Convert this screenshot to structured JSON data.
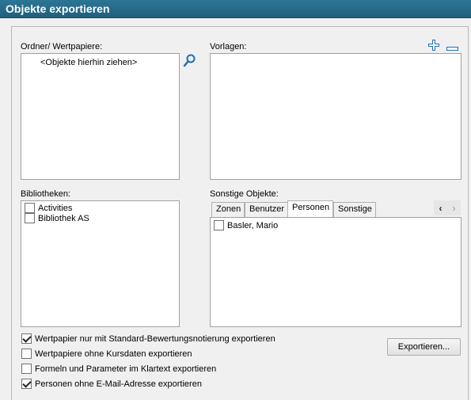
{
  "window": {
    "title": "Objekte exportieren"
  },
  "folders": {
    "label": "Ordner/ Wertpapiere:",
    "placeholder": "<Objekte hierhin ziehen>",
    "search_icon": "magnifier-icon"
  },
  "templates": {
    "label": "Vorlagen:",
    "add_icon": "plus-icon",
    "remove_icon": "minus-icon"
  },
  "libraries": {
    "label": "Bibliotheken:",
    "items": [
      {
        "label": "Activities",
        "checked": false
      },
      {
        "label": "Bibliothek AS",
        "checked": false
      }
    ]
  },
  "other_objects": {
    "label": "Sonstige Objekte:",
    "tabs": [
      "Zonen",
      "Benutzer",
      "Personen",
      "Sonstige"
    ],
    "active_tab": "Personen",
    "scroll_left": "‹",
    "scroll_right": "›",
    "items": [
      {
        "label": "Basler, Mario",
        "checked": false
      }
    ]
  },
  "options": [
    {
      "label": "Wertpapier nur mit Standard-Bewertungsnotierung exportieren",
      "checked": true
    },
    {
      "label": "Wertpapiere ohne Kursdaten exportieren",
      "checked": false
    },
    {
      "label": "Formeln und Parameter im Klartext exportieren",
      "checked": false
    },
    {
      "label": "Personen ohne E-Mail-Adresse exportieren",
      "checked": true
    }
  ],
  "export_button": {
    "label": "Exportieren..."
  }
}
